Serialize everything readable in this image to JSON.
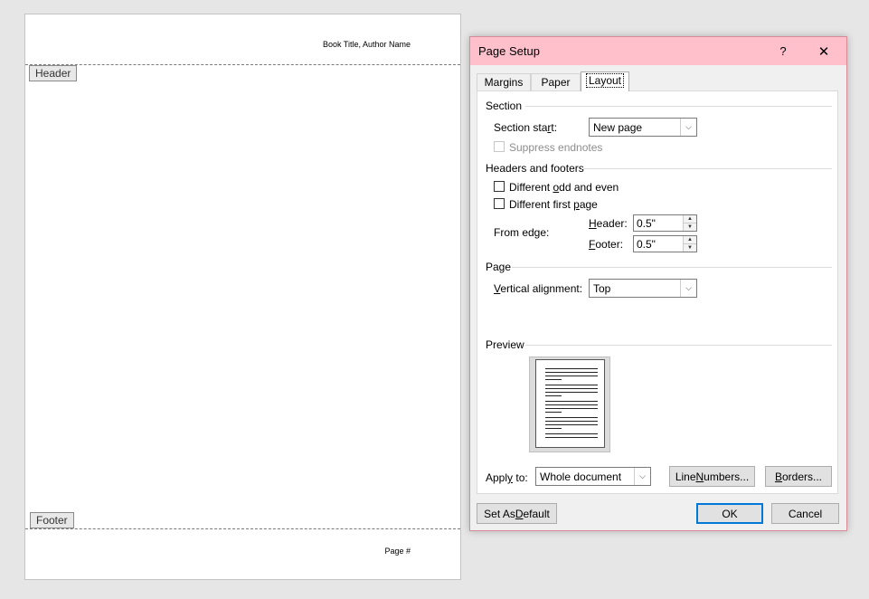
{
  "document": {
    "header_text": "Book Title, Author Name",
    "header_tag": "Header",
    "footer_tag": "Footer",
    "footer_text": "Page #"
  },
  "dialog": {
    "title": "Page Setup",
    "help": "?",
    "close": "✕",
    "tabs": [
      "Margins",
      "Paper",
      "Layout"
    ],
    "active_tab": "Layout",
    "section": {
      "heading": "Section",
      "section_start_label_pre": "Section sta",
      "section_start_label_u": "r",
      "section_start_label_post": "t:",
      "section_start_value": "New page",
      "suppress_endnotes": "Suppress endnotes",
      "suppress_endnotes_checked": false
    },
    "headers_footers": {
      "heading": "Headers and footers",
      "odd_even_pre": "Different ",
      "odd_even_u": "o",
      "odd_even_post": "dd and even",
      "odd_even_checked": false,
      "first_page_pre": "Different first ",
      "first_page_u": "p",
      "first_page_post": "age",
      "first_page_checked": false,
      "from_edge": "From edge:",
      "header_label_u": "H",
      "header_label_post": "eader:",
      "header_value": "0.5\"",
      "footer_label_u": "F",
      "footer_label_post": "ooter:",
      "footer_value": "0.5\""
    },
    "page": {
      "heading": "Page",
      "valign_label_u": "V",
      "valign_label_post": "ertical alignment:",
      "valign_value": "Top"
    },
    "preview": {
      "heading": "Preview"
    },
    "apply_to": {
      "label_pre": "Appl",
      "label_u": "y",
      "label_post": " to:",
      "value": "Whole document"
    },
    "buttons": {
      "line_numbers_pre": "Line ",
      "line_numbers_u": "N",
      "line_numbers_post": "umbers...",
      "borders_u": "B",
      "borders_post": "orders...",
      "set_default_pre": "Set As ",
      "set_default_u": "D",
      "set_default_post": "efault",
      "ok": "OK",
      "cancel": "Cancel"
    }
  }
}
